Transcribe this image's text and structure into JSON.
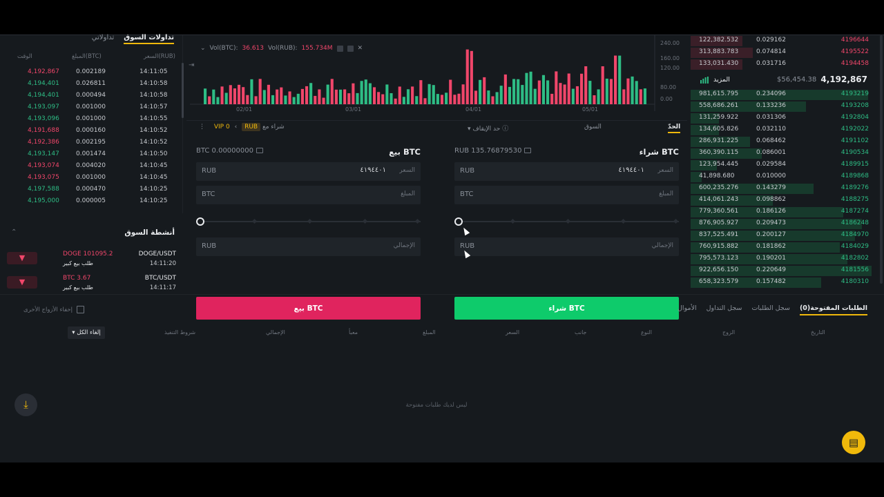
{
  "trades_panel": {
    "tabs": [
      "تداولات السوق",
      "تداولاتي"
    ],
    "headers": {
      "price": "السعر(RUB)",
      "amount": "المبلغ(BTC)",
      "time": "الوقت"
    },
    "rows": [
      {
        "price": "4,192,867",
        "amount": "0.002189",
        "time": "14:11:05",
        "side": "red"
      },
      {
        "price": "4,194,401",
        "amount": "0.026811",
        "time": "14:10:58",
        "side": "green"
      },
      {
        "price": "4,194,401",
        "amount": "0.000494",
        "time": "14:10:58",
        "side": "green"
      },
      {
        "price": "4,193,097",
        "amount": "0.001000",
        "time": "14:10:57",
        "side": "green"
      },
      {
        "price": "4,193,096",
        "amount": "0.001000",
        "time": "14:10:55",
        "side": "green"
      },
      {
        "price": "4,191,688",
        "amount": "0.000160",
        "time": "14:10:52",
        "side": "red"
      },
      {
        "price": "4,192,386",
        "amount": "0.002195",
        "time": "14:10:52",
        "side": "red"
      },
      {
        "price": "4,193,147",
        "amount": "0.001474",
        "time": "14:10:50",
        "side": "green"
      },
      {
        "price": "4,193,074",
        "amount": "0.004020",
        "time": "14:10:45",
        "side": "red"
      },
      {
        "price": "4,193,075",
        "amount": "0.001000",
        "time": "14:10:45",
        "side": "red"
      },
      {
        "price": "4,197,588",
        "amount": "0.000470",
        "time": "14:10:25",
        "side": "green"
      },
      {
        "price": "4,195,000",
        "amount": "0.000005",
        "time": "14:10:25",
        "side": "green"
      }
    ]
  },
  "market_activity": {
    "title": "أنشطة السوق",
    "items": [
      {
        "value": "DOGE 101095.2",
        "sub": "طلب بيع كبير",
        "pair": "DOGE/USDT",
        "time": "14:11:20"
      },
      {
        "value": "BTC 3.67",
        "sub": "طلب بيع كبير",
        "pair": "BTC/USDT",
        "time": "14:11:17"
      }
    ]
  },
  "chart": {
    "legend_btc": "Vol(BTC):",
    "legend_btc_val": "36.613",
    "legend_rub": "Vol(RUB):",
    "legend_rub_val": "155.734M",
    "y_ticks": [
      "240.00",
      "160.00",
      "120.00",
      "80.00",
      "0.00"
    ],
    "x_ticks": [
      "02/01",
      "03/01",
      "04/01",
      "05/01"
    ]
  },
  "order_form": {
    "tabs": {
      "limit": "الحدّ",
      "market": "السوق",
      "stop": "حد الإيقاف"
    },
    "vip": "VIP 0",
    "rub_pill": "RUB",
    "trade_with": "شراء مع",
    "buy": {
      "title": "شراء BTC",
      "balance": "RUB 135.76879530",
      "price_cur": "RUB",
      "price_label": "السعر",
      "price_val": "٤١٩٤٤٠١",
      "amount_cur": "BTC",
      "amount_label": "المبلغ",
      "total_cur": "RUB",
      "total_label": "الإجمالي",
      "button": "شراء BTC"
    },
    "sell": {
      "title": "بيع BTC",
      "balance": "BTC 0.00000000",
      "price_cur": "RUB",
      "price_label": "السعر",
      "price_val": "٤١٩٤٤٠١",
      "amount_cur": "BTC",
      "amount_label": "المبلغ",
      "total_cur": "RUB",
      "total_label": "الإجمالي",
      "button": "بيع BTC"
    }
  },
  "order_book": {
    "asks": [
      {
        "total": "122,382.532",
        "amount": "0.029162",
        "price": "4196644"
      },
      {
        "total": "313,883.783",
        "amount": "0.074814",
        "price": "4195522"
      },
      {
        "total": "133,031.430",
        "amount": "0.031716",
        "price": "4194458"
      }
    ],
    "last_price": "4,192,867",
    "usd_price": "$56,454.38",
    "more": "المزيد",
    "bids": [
      {
        "total": "981,615.795",
        "amount": "0.234096",
        "price": "4193219",
        "depth": 0.95
      },
      {
        "total": "558,686.261",
        "amount": "0.133236",
        "price": "4193208",
        "depth": 0.62
      },
      {
        "total": "131,259.922",
        "amount": "0.031306",
        "price": "4192804",
        "depth": 0.15
      },
      {
        "total": "134,605.826",
        "amount": "0.032110",
        "price": "4192022",
        "depth": 0.15
      },
      {
        "total": "286,931.225",
        "amount": "0.068462",
        "price": "4191102",
        "depth": 0.32
      },
      {
        "total": "360,390.115",
        "amount": "0.086001",
        "price": "4190534",
        "depth": 0.38
      },
      {
        "total": "123,954.445",
        "amount": "0.029584",
        "price": "4189915",
        "depth": 0.14
      },
      {
        "total": "41,898.680",
        "amount": "0.010000",
        "price": "4189868",
        "depth": 0.06
      },
      {
        "total": "600,235.276",
        "amount": "0.143279",
        "price": "4189276",
        "depth": 0.66
      },
      {
        "total": "414,061.243",
        "amount": "0.098862",
        "price": "4188275",
        "depth": 0.44
      },
      {
        "total": "779,360.561",
        "amount": "0.186126",
        "price": "4187274",
        "depth": 0.82
      },
      {
        "total": "876,905.927",
        "amount": "0.209473",
        "price": "4186248",
        "depth": 0.92
      },
      {
        "total": "837,525.491",
        "amount": "0.200127",
        "price": "4184970",
        "depth": 0.88
      },
      {
        "total": "760,915.882",
        "amount": "0.181862",
        "price": "4184029",
        "depth": 0.8
      },
      {
        "total": "795,573.123",
        "amount": "0.190201",
        "price": "4182802",
        "depth": 0.84
      },
      {
        "total": "922,656.150",
        "amount": "0.220649",
        "price": "4181556",
        "depth": 0.97
      },
      {
        "total": "658,323.579",
        "amount": "0.157482",
        "price": "4180310",
        "depth": 0.7
      }
    ]
  },
  "orders": {
    "tabs": [
      "الطلبات المفتوحة(0)",
      "سجل الطلبات",
      "سجل التداول",
      "الأموال"
    ],
    "hide_pairs": "إخفاء الأزواج الأخرى",
    "columns": [
      "التاريخ",
      "الزوج",
      "النوع",
      "جانب",
      "السعر",
      "المبلغ",
      "معبأ",
      "الإجمالي",
      "شروط التنفيذ"
    ],
    "cancel_all": "إلغاء الكل",
    "empty": "ليس لديك طلبات مفتوحة"
  },
  "colors": {
    "green": "#2ebd85",
    "red": "#f0466a",
    "accent": "#f0b90b",
    "buy": "#0ecb6b",
    "sell": "#e0245e"
  }
}
